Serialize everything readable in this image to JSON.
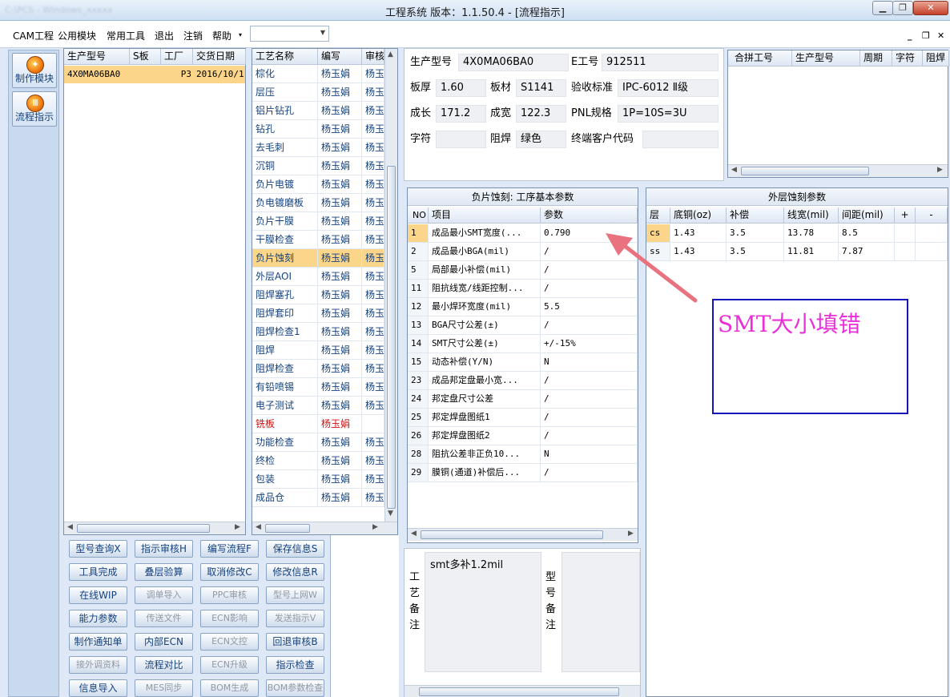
{
  "window": {
    "title": "工程系统   版本：1.1.50.4 - [流程指示]",
    "blur_text": "C:\\PCS - Windows_xxxxx"
  },
  "menu": {
    "items": [
      "CAM工程",
      "公用模块",
      "常用工具",
      "退出",
      "注销",
      "帮助"
    ],
    "combo_value": ""
  },
  "modules": [
    {
      "label": "制作模块"
    },
    {
      "label": "流程指示"
    }
  ],
  "order_grid": {
    "headers": [
      "生产型号",
      "S板",
      "工厂",
      "交货日期"
    ],
    "rows": [
      [
        "4X0MA06BA0",
        "",
        "P3",
        "2016/10/1"
      ]
    ]
  },
  "process_grid": {
    "headers": [
      "工艺名称",
      "编写",
      "审核"
    ],
    "rows": [
      {
        "name": "棕化",
        "writer": "杨玉娟",
        "reviewer": "杨玉"
      },
      {
        "name": "层压",
        "writer": "杨玉娟",
        "reviewer": "杨玉"
      },
      {
        "name": "铝片钻孔",
        "writer": "杨玉娟",
        "reviewer": "杨玉"
      },
      {
        "name": "钻孔",
        "writer": "杨玉娟",
        "reviewer": "杨玉"
      },
      {
        "name": "去毛刺",
        "writer": "杨玉娟",
        "reviewer": "杨玉"
      },
      {
        "name": "沉铜",
        "writer": "杨玉娟",
        "reviewer": "杨玉"
      },
      {
        "name": "负片电镀",
        "writer": "杨玉娟",
        "reviewer": "杨玉"
      },
      {
        "name": "负电镀磨板",
        "writer": "杨玉娟",
        "reviewer": "杨玉"
      },
      {
        "name": "负片干膜",
        "writer": "杨玉娟",
        "reviewer": "杨玉"
      },
      {
        "name": "干膜检查",
        "writer": "杨玉娟",
        "reviewer": "杨玉"
      },
      {
        "name": "负片蚀刻",
        "writer": "杨玉娟",
        "reviewer": "杨玉"
      },
      {
        "name": "外层AOI",
        "writer": "杨玉娟",
        "reviewer": "杨玉"
      },
      {
        "name": "阻焊塞孔",
        "writer": "杨玉娟",
        "reviewer": "杨玉"
      },
      {
        "name": "阻焊套印",
        "writer": "杨玉娟",
        "reviewer": "杨玉"
      },
      {
        "name": "阻焊检查1",
        "writer": "杨玉娟",
        "reviewer": "杨玉"
      },
      {
        "name": "阻焊",
        "writer": "杨玉娟",
        "reviewer": "杨玉"
      },
      {
        "name": "阻焊检查",
        "writer": "杨玉娟",
        "reviewer": "杨玉"
      },
      {
        "name": "有铅喷锡",
        "writer": "杨玉娟",
        "reviewer": "杨玉"
      },
      {
        "name": "电子测试",
        "writer": "杨玉娟",
        "reviewer": "杨玉"
      },
      {
        "name": "铣板",
        "writer": "杨玉娟",
        "reviewer": ""
      },
      {
        "name": "功能检查",
        "writer": "杨玉娟",
        "reviewer": "杨玉"
      },
      {
        "name": "终检",
        "writer": "杨玉娟",
        "reviewer": "杨玉"
      },
      {
        "name": "包装",
        "writer": "杨玉娟",
        "reviewer": "杨玉"
      },
      {
        "name": "成品仓",
        "writer": "杨玉娟",
        "reviewer": "杨玉"
      }
    ]
  },
  "buttons": [
    [
      "型号查询X",
      "指示审核H",
      "编写流程F",
      "保存信息S"
    ],
    [
      "工具完成",
      "叠层验算",
      "取消修改C",
      "修改信息R"
    ],
    [
      "在线WIP",
      "调单导入",
      "PPC审核",
      "型号上网W"
    ],
    [
      "能力参数",
      "传送文件",
      "ECN影响",
      "发送指示V"
    ],
    [
      "制作通知单",
      "内部ECN",
      "ECN文控",
      "回退审核B"
    ],
    [
      "接外调资料",
      "流程对比",
      "ECN升级",
      "指示检查"
    ],
    [
      "信息导入",
      "MES同步",
      "BOM生成",
      "BOM参数检查"
    ]
  ],
  "info": {
    "prod_model_label": "生产型号",
    "prod_model": "4X0MA06BA0",
    "e_eng_label": "E工号",
    "e_eng": "912511",
    "thickness_label": "板厚",
    "thickness": "1.60",
    "material_label": "板材",
    "material": "S1141",
    "acceptance_label": "验收标准",
    "acceptance": "IPC-6012 Ⅱ级",
    "length_label": "成长",
    "length": "171.2",
    "width_label": "成宽",
    "width": "122.3",
    "pnl_label": "PNL规格",
    "pnl": "1P=10S=3U",
    "char_label": "字符",
    "char": "",
    "solder_label": "阻焊",
    "solder": "绿色",
    "cust_code_label": "终端客户代码",
    "cust_code": ""
  },
  "merge_grid": {
    "headers": [
      "合拼工号",
      "生产型号",
      "周期",
      "字符",
      "阻焊"
    ]
  },
  "etch_params": {
    "title": "负片蚀刻: 工序基本参数",
    "headers": [
      "NO",
      "项目",
      "参数"
    ],
    "rows": [
      {
        "no": "1",
        "item": "成品最小SMT宽度(...",
        "param": "0.790"
      },
      {
        "no": "2",
        "item": "成品最小BGA(mil)",
        "param": "/"
      },
      {
        "no": "5",
        "item": "局部最小补偿(mil)",
        "param": "/"
      },
      {
        "no": "11",
        "item": "阻抗线宽/线距控制...",
        "param": "/"
      },
      {
        "no": "12",
        "item": "最小焊环宽度(mil)",
        "param": "5.5"
      },
      {
        "no": "13",
        "item": "BGA尺寸公差(±)",
        "param": "/"
      },
      {
        "no": "14",
        "item": "SMT尺寸公差(±)",
        "param": "+/-15%"
      },
      {
        "no": "15",
        "item": "动态补偿(Y/N)",
        "param": "N"
      },
      {
        "no": "23",
        "item": "成品邦定盘最小宽...",
        "param": "/"
      },
      {
        "no": "24",
        "item": "邦定盘尺寸公差",
        "param": "/"
      },
      {
        "no": "25",
        "item": "邦定焊盘图纸1",
        "param": "/"
      },
      {
        "no": "26",
        "item": "邦定焊盘图纸2",
        "param": "/"
      },
      {
        "no": "28",
        "item": "阻抗公差非正负10...",
        "param": "N"
      },
      {
        "no": "29",
        "item": "膜铜(通道)补偿后...",
        "param": "/"
      }
    ]
  },
  "outer_etch": {
    "title": "外层蚀刻参数",
    "headers": [
      "层",
      "底铜(oz)",
      "补偿",
      "线宽(mil)",
      "间距(mil)",
      "+",
      "-"
    ],
    "rows": [
      [
        "cs",
        "1.43",
        "3.5",
        "13.78",
        "8.5"
      ],
      [
        "ss",
        "1.43",
        "3.5",
        "11.81",
        "7.87"
      ]
    ]
  },
  "remarks": {
    "process_label": "工艺备注",
    "process_text": "smt多补1.2mil",
    "model_label": "型号备注",
    "model_text": ""
  },
  "annotation": {
    "text": "SMT大小填错"
  },
  "colors": {
    "selected": "#fbd58a",
    "highlight_text": "#d01010",
    "annot_text": "#ea2fd9",
    "arrow": "#e8737f"
  }
}
